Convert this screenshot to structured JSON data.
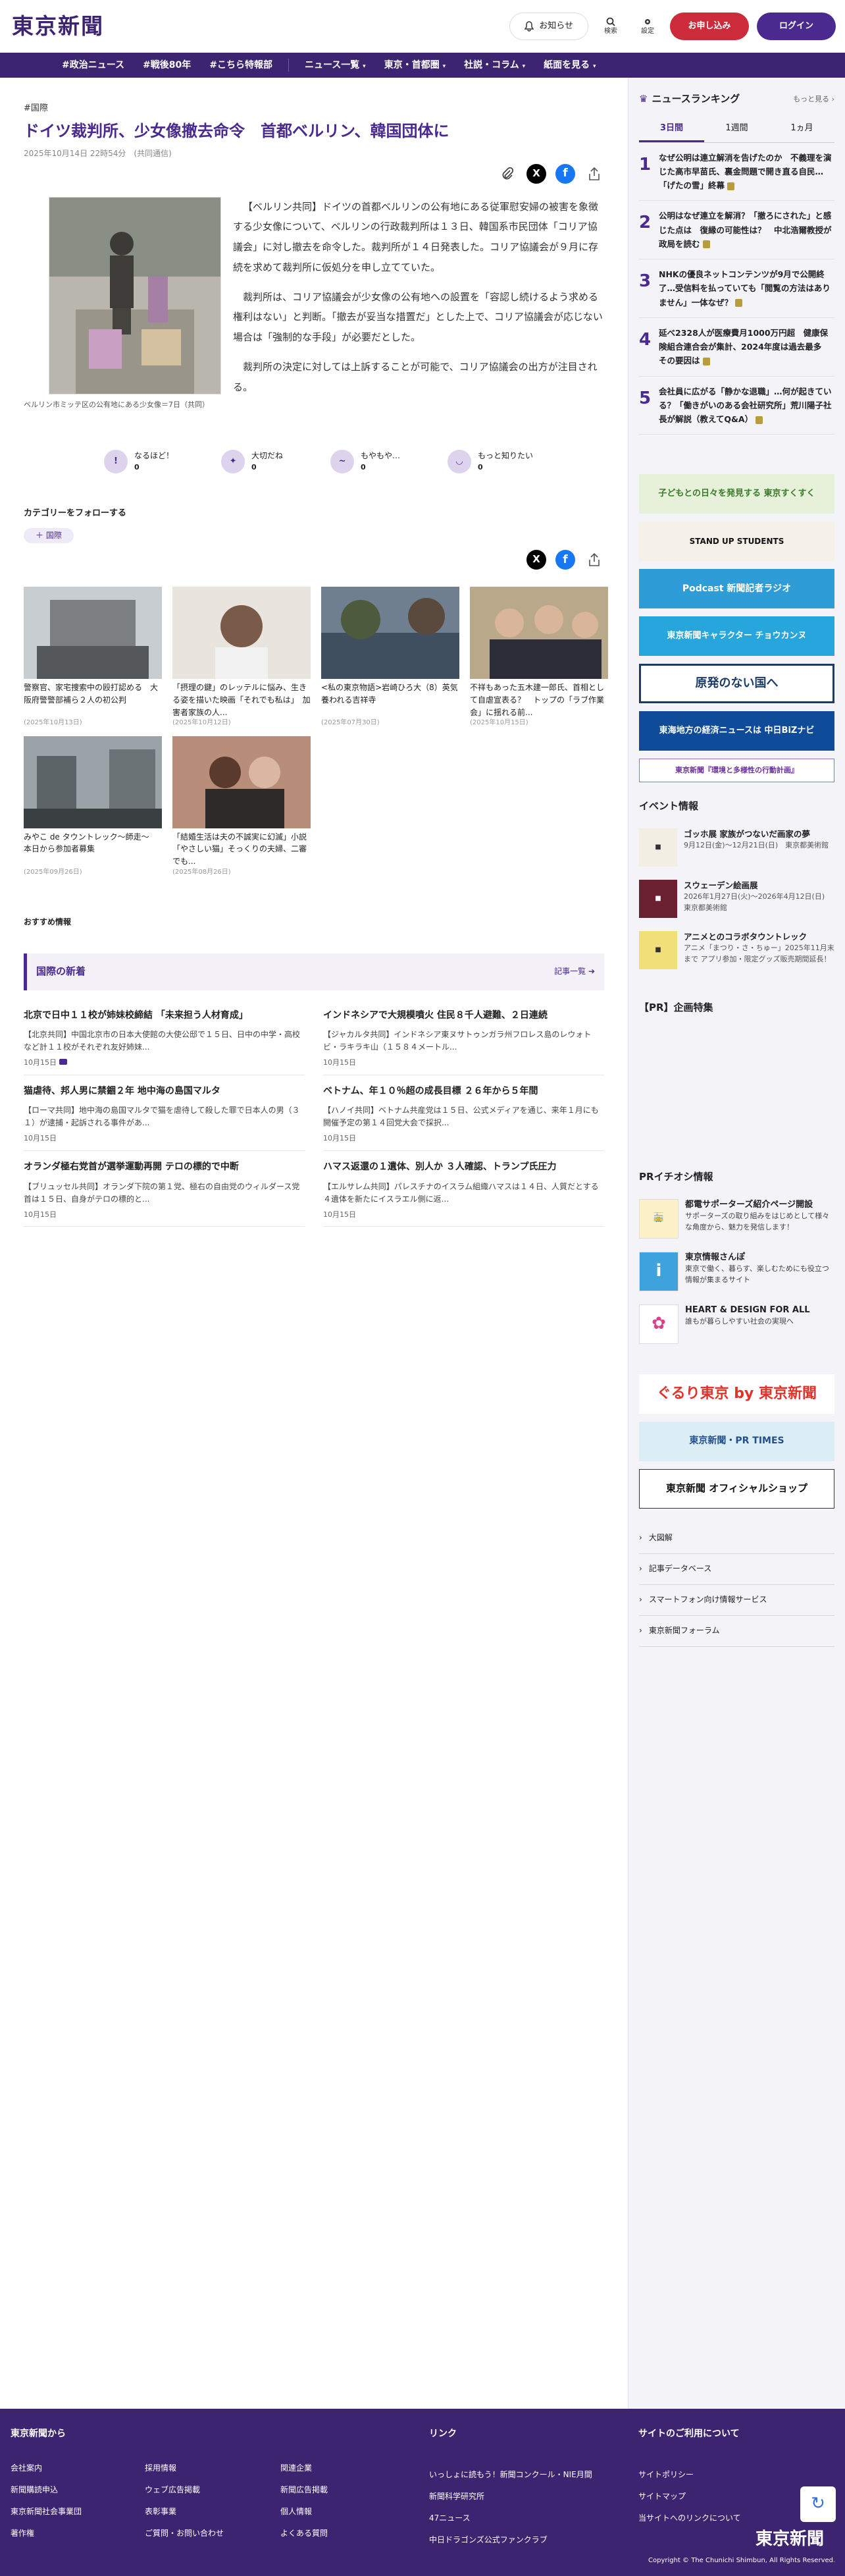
{
  "header": {
    "logo": "東京新聞",
    "notify": "お知らせ",
    "search": "検索",
    "settings": "設定",
    "apply": "お申し込み",
    "login": "ログイン"
  },
  "nav": {
    "items": [
      "#政治ニュース",
      "#戦後80年",
      "#こちら特報部"
    ],
    "menus": [
      "ニュース一覧",
      "東京・首都圏",
      "社説・コラム",
      "紙面を見る"
    ]
  },
  "article": {
    "tag": "#国際",
    "title": "ドイツ裁判所、少女像撤去命令　首都ベルリン、韓国団体に",
    "meta": "2025年10月14日 22時54分　(共同通信)",
    "caption": "ベルリン市ミッテ区の公有地にある少女像＝7日（共同）",
    "paragraphs": [
      "【ベルリン共同】ドイツの首都ベルリンの公有地にある従軍慰安婦の被害を象徴する少女像について、ベルリンの行政裁判所は１３日、韓国系市民団体「コリア協議会」に対し撤去を命令した。裁判所が１４日発表した。コリア協議会が９月に存続を求めて裁判所に仮処分を申し立てていた。",
      "裁判所は、コリア協議会が少女像の公有地への設置を「容認し続けるよう求める権利はない」と判断。「撤去が妥当な措置だ」とした上で、コリア協議会が応じない場合は「強制的な手段」が必要だとした。",
      "裁判所の決定に対しては上訴することが可能で、コリア協議会の出方が注目される。"
    ]
  },
  "reactions": [
    {
      "label": "なるほど！",
      "count": "0"
    },
    {
      "label": "大切だね",
      "count": "0"
    },
    {
      "label": "もやもや…",
      "count": "0"
    },
    {
      "label": "もっと知りたい",
      "count": "0"
    }
  ],
  "follow": {
    "title": "カテゴリーをフォローする",
    "tag": "国際"
  },
  "related": [
    {
      "title": "警察官、家宅捜索中の殴打認める　大阪府警警部補ら２人の初公判",
      "date": "(2025年10月13日)"
    },
    {
      "title": "「摂理の鍵」のレッテルに悩み、生きる姿を描いた映画「それでも私は」　加害者家族の人...",
      "date": "(2025年10月12日)"
    },
    {
      "title": "<私の東京物語>岩崎ひろ大（8）英気養われる吉祥寺",
      "date": "(2025年07月30日)"
    },
    {
      "title": "不祥もあった五木建一郎氏、首相として自虐宣表る？　トップの「ラブ作業会」に揺れる前...",
      "date": "(2025年10月15日)"
    },
    {
      "title": "みやこ de タウントレック〜師走〜　本日から参加者募集",
      "date": "(2025年09月26日)"
    },
    {
      "title": "「結婚生活は夫の不誠実に幻滅」小説「やさしい猫」そっくりの夫婦、二審でも...",
      "date": "(2025年08月26日)"
    }
  ],
  "recommend": "おすすめ情報",
  "latest": {
    "title": "国際の新着",
    "more": "記事一覧",
    "items": [
      {
        "title": "北京で日中１１校が姉妹校締結 「未来担う人材育成」",
        "body": "【北京共同】中国北京市の日本大使館の大使公邸で１５日、日中の中学・高校など計１１校がそれぞれ友好姉妹...",
        "date": "10月15日"
      },
      {
        "title": "インドネシアで大規模噴火 住民８千人避難、２日連続",
        "body": "【ジャカルタ共同】インドネシア東ヌサトゥンガラ州フロレス島のレウォトビ・ラキラキ山（１５８４メートル...",
        "date": "10月15日"
      },
      {
        "title": "猫虐待、邦人男に禁錮２年 地中海の島国マルタ",
        "body": "【ローマ共同】地中海の島国マルタで猫を虐待して殺した罪で日本人の男（３１）が逮捕・起訴される事件があ...",
        "date": "10月15日"
      },
      {
        "title": "ベトナム、年１０％超の成長目標 ２６年から５年間",
        "body": "【ハノイ共同】ベトナム共産党は１５日、公式メディアを通じ、来年１月にも開催予定の第１４回党大会で採択...",
        "date": "10月15日"
      },
      {
        "title": "オランダ極右党首が選挙運動再開 テロの標的で中断",
        "body": "【ブリュッセル共同】オランダ下院の第１党、極右の自由党のウィルダース党首は１５日、自身がテロの標的と...",
        "date": "10月15日"
      },
      {
        "title": "ハマス返還の１遺体、別人か ３人確認、トランプ氏圧力",
        "body": "【エルサレム共同】パレスチナのイスラム組織ハマスは１４日、人質だとする４遺体を新たにイスラエル側に返...",
        "date": "10月15日"
      }
    ]
  },
  "ranking": {
    "title": "ニュースランキング",
    "more": "もっと見る",
    "tabs": [
      "3日間",
      "1週間",
      "1ヵ月"
    ],
    "items": [
      {
        "num": "1",
        "text": "なぜ公明は連立解消を告げたのか　不義理を演じた高市早苗氏、裏金問題で開き直る自民…「げたの雪」終幕"
      },
      {
        "num": "2",
        "text": "公明はなぜ連立を解消？「撤ろにされた」と感じた点は　復縁の可能性は？　中北浩爾教授が政局を読む"
      },
      {
        "num": "3",
        "text": "NHKの優良ネットコンテンツが9月で公開終了…受信料を払っていても「閲覧の方法はありません」一体なぜ？"
      },
      {
        "num": "4",
        "text": "延べ2328人が医療費月1000万円超　健康保険組合連合会が集計、2024年度は過去最多　その要因は"
      },
      {
        "num": "5",
        "text": "会社員に広がる「静かな退職」…何が起きている？「働きがいのある会社研究所」荒川陽子社長が解説（教えてQ&A）"
      }
    ]
  },
  "banners": [
    "子どもとの日々を発見する 東京すくすく",
    "STAND UP STUDENTS",
    "Podcast 新聞記者ラジオ",
    "東京新聞キャラクター チョウカンヌ",
    "原発のない国へ",
    "東海地方の経済ニュースは 中日BiZナビ",
    "東京新聞『環境と多様性の行動計画』"
  ],
  "events": {
    "title": "イベント情報",
    "items": [
      {
        "title": "ゴッホ展 家族がつないだ画家の夢",
        "detail": "9月12日(金)〜12月21日(日)　東京都美術館"
      },
      {
        "title": "スウェーデン絵画展",
        "detail": "2026年1月27日(火)〜2026年4月12日(日)　東京都美術館"
      },
      {
        "title": "アニメとのコラボタウントレック",
        "detail": "アニメ「まつり・さ・ちゅー」2025年11月末まで アプリ参加・限定グッズ販売期間延長！"
      }
    ]
  },
  "pr_special": "【PR】企画特集",
  "pr_info": {
    "title": "PRイチオシ情報",
    "items": [
      {
        "title": "都電サポーターズ紹介ページ開設",
        "detail": "サポーターズの取り組みをはじめとして様々な角度から、魅力を発信します！"
      },
      {
        "title": "東京情報さんぽ",
        "detail": "東京で働く、暮らす、楽しむためにも役立つ情報が集まるサイト"
      },
      {
        "title": "HEART & DESIGN FOR ALL",
        "detail": "誰もが暮らしやすい社会の実現へ"
      }
    ]
  },
  "shop_banners": [
    "ぐるり東京 by 東京新聞",
    "東京新聞・PR TIMES",
    "東京新聞 オフィシャルショップ"
  ],
  "side_links": [
    "大図解",
    "記事データベース",
    "スマートフォン向け情報サービス",
    "東京新聞フォーラム"
  ],
  "footer": {
    "col1_title": "東京新聞から",
    "col1_links": [
      "会社案内",
      "新聞購読申込",
      "東京新聞社会事業団",
      "著作権",
      "採用情報",
      "ウェブ広告掲載",
      "表彰事業",
      "ご質問・お問い合わせ",
      "関連企業",
      "新聞広告掲載",
      "個人情報",
      "よくある質問"
    ],
    "col2_title": "リンク",
    "col2_links": [
      "いっしょに読もう！新聞コンクール・NIE月間",
      "新聞科学研究所",
      "47ニュース",
      "中日ドラゴンズ公式ファンクラブ"
    ],
    "col3_title": "サイトのご利用について",
    "col3_links": [
      "サイトポリシー",
      "サイトマップ",
      "当サイトへのリンクについて"
    ],
    "logo": "東京新聞",
    "copyright": "Copyright © The Chunichi Shimbun, All Rights Reserved."
  },
  "colors": {
    "brand": "#3c2470",
    "accent": "#4a2a8f",
    "danger": "#cc2b3b"
  }
}
